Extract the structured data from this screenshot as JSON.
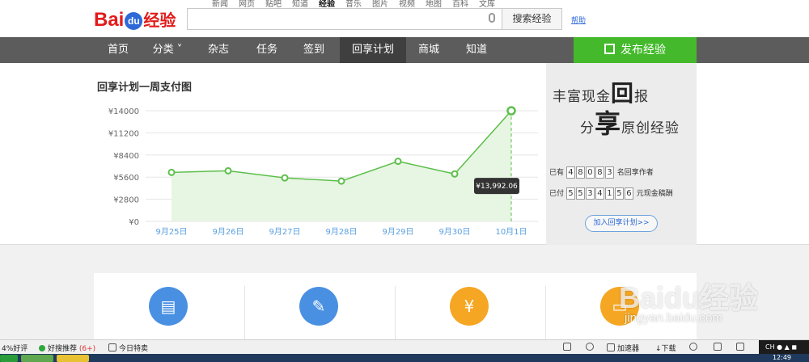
{
  "logo": {
    "bai": "Bai",
    "du": "du",
    "jingyan": "经验"
  },
  "top_nav": [
    "新闻",
    "网页",
    "贴吧",
    "知道",
    "经验",
    "音乐",
    "图片",
    "视频",
    "地图",
    "百科",
    "文库"
  ],
  "top_nav_active": "经验",
  "search": {
    "value": "",
    "button": "搜索经验",
    "help": "帮助"
  },
  "main_nav": [
    {
      "label": "首页"
    },
    {
      "label": "分类 ˅"
    },
    {
      "label": "杂志"
    },
    {
      "label": "任务"
    },
    {
      "label": "签到"
    },
    {
      "label": "回享计划"
    },
    {
      "label": "商城"
    },
    {
      "label": "知道"
    }
  ],
  "main_nav_active": "回享计划",
  "publish_button": "发布经验",
  "chart_title": "回享计划一周支付图",
  "chart_data": {
    "type": "area",
    "title": "回享计划一周支付图",
    "categories": [
      "9月25日",
      "9月26日",
      "9月27日",
      "9月28日",
      "9月29日",
      "9月30日",
      "10月1日"
    ],
    "series": [
      {
        "values": [
          6200,
          6400,
          5500,
          5100,
          7600,
          6000,
          13992.06
        ]
      }
    ],
    "yticks": [
      "¥14000",
      "¥11200",
      "¥8400",
      "¥5600",
      "¥2800",
      "¥0"
    ],
    "ylim": [
      0,
      14000
    ],
    "tooltip": "¥13,992.06",
    "grid": true,
    "colors": {
      "line": "#5cbf4a",
      "fill": "#e7f5e3"
    }
  },
  "promo": {
    "line1_a": "丰富现金",
    "line1_big": "回",
    "line1_b": "报",
    "line2_a": "分",
    "line2_big": "享",
    "line2_b": "原创经验",
    "authors_prefix": "已有",
    "authors_digits": [
      "4",
      "8",
      "0",
      "8",
      "3"
    ],
    "authors_suffix": "名回享作者",
    "paid_prefix": "已付",
    "paid_digits": [
      "5",
      "5",
      "3",
      "4",
      "1",
      "5",
      "6"
    ],
    "paid_suffix": "元现金稿酬",
    "join_button": "加入回享计划>>"
  },
  "cards": [
    {
      "icon": "book-icon",
      "color": "#4a90e2"
    },
    {
      "icon": "edit-icon",
      "color": "#4a90e2"
    },
    {
      "icon": "money-bag-icon",
      "color": "#f5a623"
    },
    {
      "icon": "wallet-icon",
      "color": "#f5a623"
    }
  ],
  "watermark": {
    "text": "Baidu经验",
    "url": "jingyan.baidu.com"
  },
  "statusbar": {
    "rating": "4%好评",
    "recommend": "好搜推荐",
    "recommend_count": "(6+)",
    "deals": "今日特卖",
    "accelerator": "加速器",
    "download": "下载",
    "lang": "CH",
    "clock": "12:49"
  }
}
